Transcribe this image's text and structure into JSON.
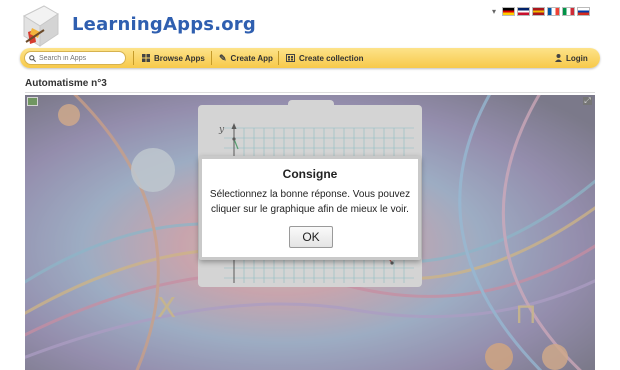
{
  "site": {
    "logo_text": "LearningApps.org"
  },
  "languages": [
    "German",
    "English",
    "Spanish",
    "French",
    "Italian",
    "Russian"
  ],
  "flag_colors": {
    "German": [
      "#000000",
      "#dd0000",
      "#ffce00"
    ],
    "English": [
      "#012169",
      "#ffffff",
      "#c8102e"
    ],
    "Spanish": [
      "#aa151b",
      "#f1bf00",
      "#aa151b"
    ],
    "French": [
      "#0055a4",
      "#ffffff",
      "#ef4135"
    ],
    "Italian": [
      "#009246",
      "#ffffff",
      "#ce2b37"
    ],
    "Russian": [
      "#ffffff",
      "#0039a6",
      "#d52b1e"
    ]
  },
  "toolbar": {
    "search_placeholder": "Search in Apps",
    "browse_label": "Browse Apps",
    "create_app_label": "Create App",
    "create_collection_label": "Create collection",
    "login_label": "Login"
  },
  "page": {
    "title": "Automatisme n°3"
  },
  "graph": {
    "axis_label_y": "y"
  },
  "dialog": {
    "title": "Consigne",
    "message": "Sélectionnez la bonne réponse. Vous pouvez cliquer sur le graphique afin de mieux le voir.",
    "ok_label": "OK"
  },
  "colors": {
    "toolbar": "#f7c94a",
    "logo": "#2f5fb0",
    "grid": "#7fd6e0"
  }
}
